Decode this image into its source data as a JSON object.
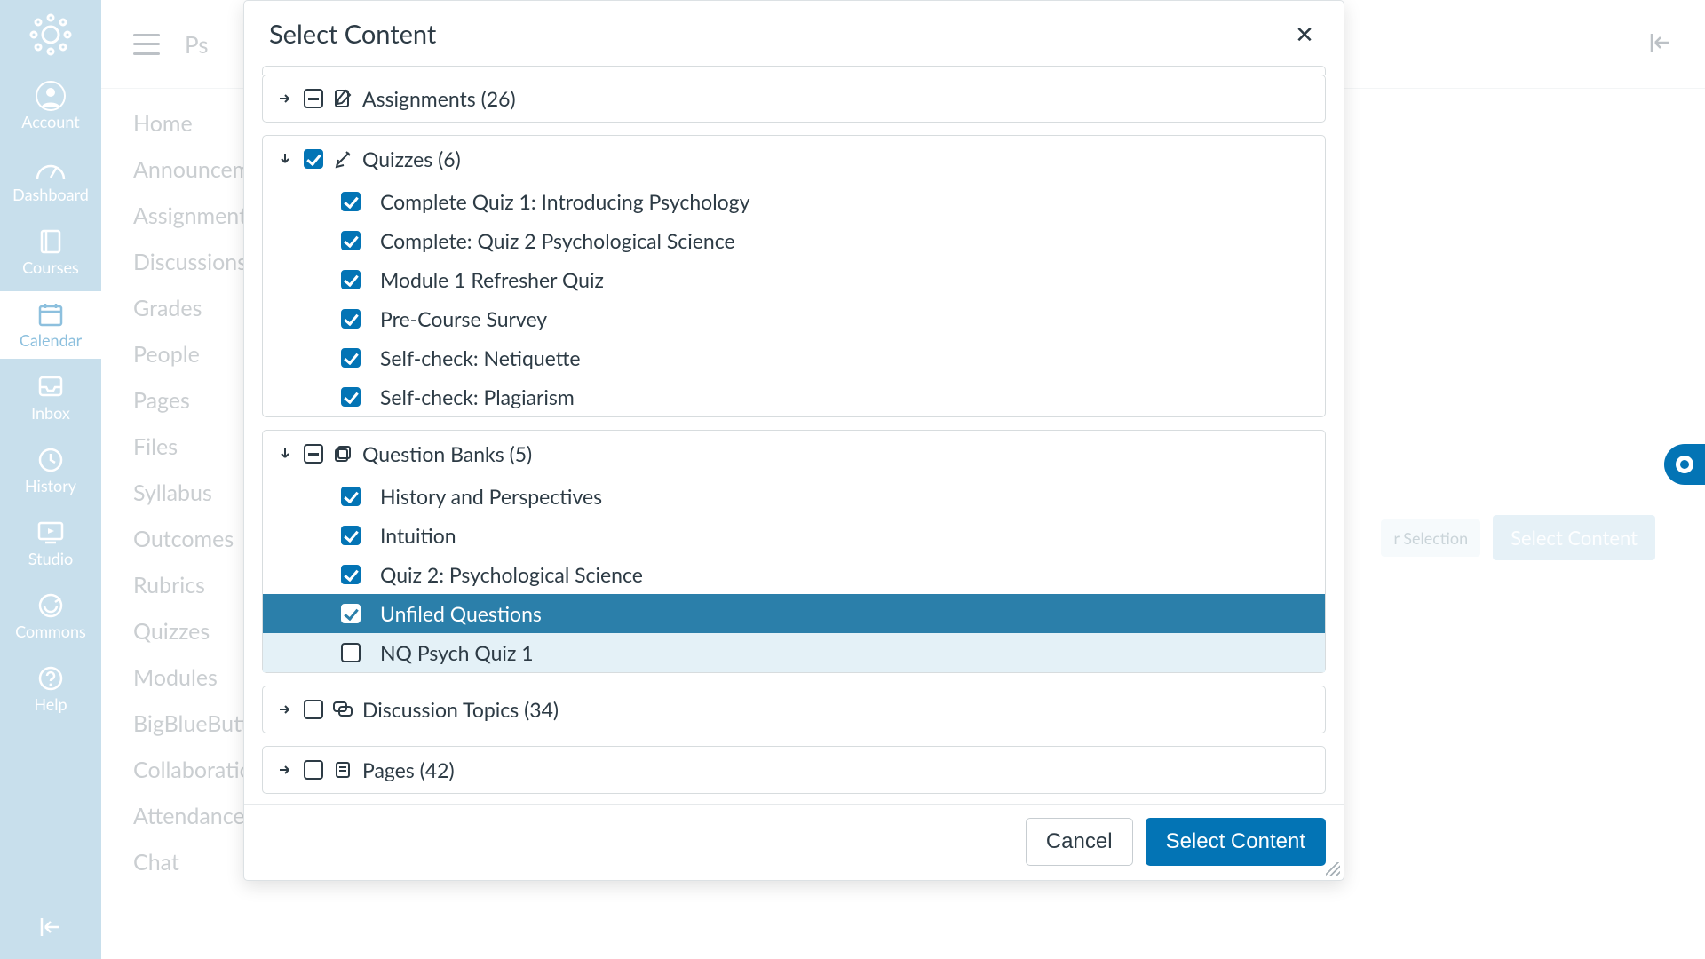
{
  "global_nav": {
    "items": [
      {
        "label": "Account"
      },
      {
        "label": "Dashboard"
      },
      {
        "label": "Courses"
      },
      {
        "label": "Calendar"
      },
      {
        "label": "Inbox"
      },
      {
        "label": "History"
      },
      {
        "label": "Studio"
      },
      {
        "label": "Commons"
      },
      {
        "label": "Help"
      }
    ]
  },
  "breadcrumb": {
    "course_prefix": "Ps"
  },
  "course_nav": {
    "items": [
      {
        "label": "Home"
      },
      {
        "label": "Announcements"
      },
      {
        "label": "Assignments"
      },
      {
        "label": "Discussions"
      },
      {
        "label": "Grades"
      },
      {
        "label": "People"
      },
      {
        "label": "Pages"
      },
      {
        "label": "Files"
      },
      {
        "label": "Syllabus"
      },
      {
        "label": "Outcomes"
      },
      {
        "label": "Rubrics"
      },
      {
        "label": "Quizzes"
      },
      {
        "label": "Modules"
      },
      {
        "label": "BigBlueButton"
      },
      {
        "label": "Collaborations"
      },
      {
        "label": "Attendance"
      },
      {
        "label": "Chat"
      }
    ]
  },
  "bg_buttons": {
    "ghost_suffix": "r Selection",
    "primary": "Select Content"
  },
  "modal": {
    "title": "Select Content",
    "groups": {
      "assignments": {
        "label": "Assignments (26)",
        "expanded": false,
        "checked": "indeterminate"
      },
      "quizzes": {
        "label": "Quizzes (6)",
        "expanded": true,
        "checked": true,
        "items": [
          {
            "label": "Complete Quiz 1: Introducing Psychology",
            "checked": true
          },
          {
            "label": "Complete: Quiz 2 Psychological Science",
            "checked": true
          },
          {
            "label": "Module 1 Refresher Quiz",
            "checked": true
          },
          {
            "label": "Pre-Course Survey",
            "checked": true
          },
          {
            "label": "Self-check: Netiquette",
            "checked": true
          },
          {
            "label": "Self-check: Plagiarism",
            "checked": true
          }
        ]
      },
      "qbanks": {
        "label": "Question Banks (5)",
        "expanded": true,
        "checked": "indeterminate",
        "items": [
          {
            "label": "History and Perspectives",
            "checked": true
          },
          {
            "label": "Intuition",
            "checked": true
          },
          {
            "label": "Quiz 2: Psychological Science",
            "checked": true
          },
          {
            "label": "Unfiled Questions",
            "checked": true,
            "selected": true
          },
          {
            "label": "NQ Psych Quiz 1",
            "checked": false,
            "hover": true
          }
        ]
      },
      "discussions": {
        "label": "Discussion Topics (34)",
        "expanded": false,
        "checked": false
      },
      "pages": {
        "label": "Pages (42)",
        "expanded": false,
        "checked": false
      }
    },
    "footer": {
      "cancel": "Cancel",
      "confirm": "Select Content"
    }
  }
}
